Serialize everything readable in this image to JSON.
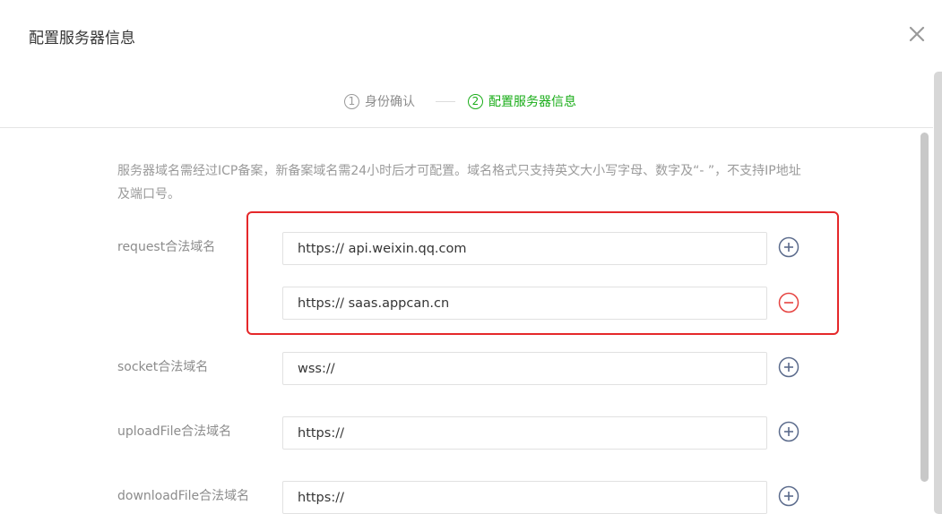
{
  "dialog": {
    "title": "配置服务器信息"
  },
  "steps": [
    {
      "number": "1",
      "label": "身份确认",
      "state": "done"
    },
    {
      "number": "2",
      "label": "配置服务器信息",
      "state": "active"
    }
  ],
  "notice": "服务器域名需经过ICP备案，新备案域名需24小时后才可配置。域名格式只支持英文大小写字母、数字及“- ”，不支持IP地址及端口号。",
  "domains": {
    "request": {
      "label": "request合法域名",
      "values": [
        "https:// api.weixin.qq.com",
        "https:// saas.appcan.cn"
      ]
    },
    "socket": {
      "label": "socket合法域名",
      "value": "wss://"
    },
    "uploadFile": {
      "label": "uploadFile合法域名",
      "value": "https://"
    },
    "downloadFile": {
      "label": "downloadFile合法域名",
      "value": "https://"
    }
  },
  "icons": {
    "close": "close-icon",
    "add": "plus-circle-icon",
    "remove": "minus-circle-icon"
  },
  "colors": {
    "accent_green": "#1aad19",
    "add_icon": "#5b6b8c",
    "remove_icon": "#e64340",
    "highlight_border": "#e5282a"
  }
}
